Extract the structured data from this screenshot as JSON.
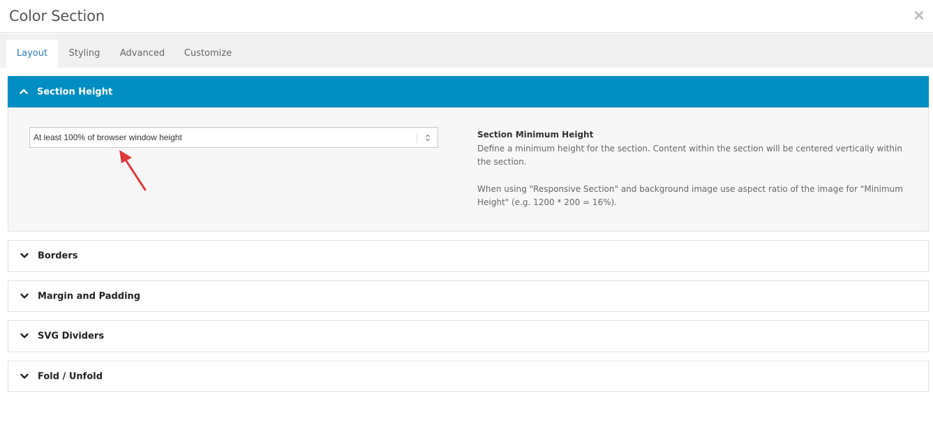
{
  "dialog": {
    "title": "Color Section",
    "close_icon": "close-icon"
  },
  "tabs": [
    {
      "label": "Layout",
      "active": true
    },
    {
      "label": "Styling",
      "active": false
    },
    {
      "label": "Advanced",
      "active": false
    },
    {
      "label": "Customize",
      "active": false
    }
  ],
  "colors": {
    "accent": "#008ec2",
    "active_tab_text": "#2b7ab8",
    "arrow": "#e03a3a"
  },
  "section_height": {
    "title": "Section Height",
    "expanded": true,
    "select_value": "At least 100% of browser window height",
    "help_title": "Section Minimum Height",
    "help_text_1": "Define a minimum height for the section. Content within the section will be centered vertically within the section.",
    "help_text_2": "When using \"Responsive Section\" and background image use aspect ratio of the image for \"Minimum Height\" (e.g. 1200 * 200 = 16%)."
  },
  "panels": [
    {
      "title": "Borders",
      "expanded": false
    },
    {
      "title": "Margin and Padding",
      "expanded": false
    },
    {
      "title": "SVG Dividers",
      "expanded": false
    },
    {
      "title": "Fold / Unfold",
      "expanded": false
    }
  ]
}
